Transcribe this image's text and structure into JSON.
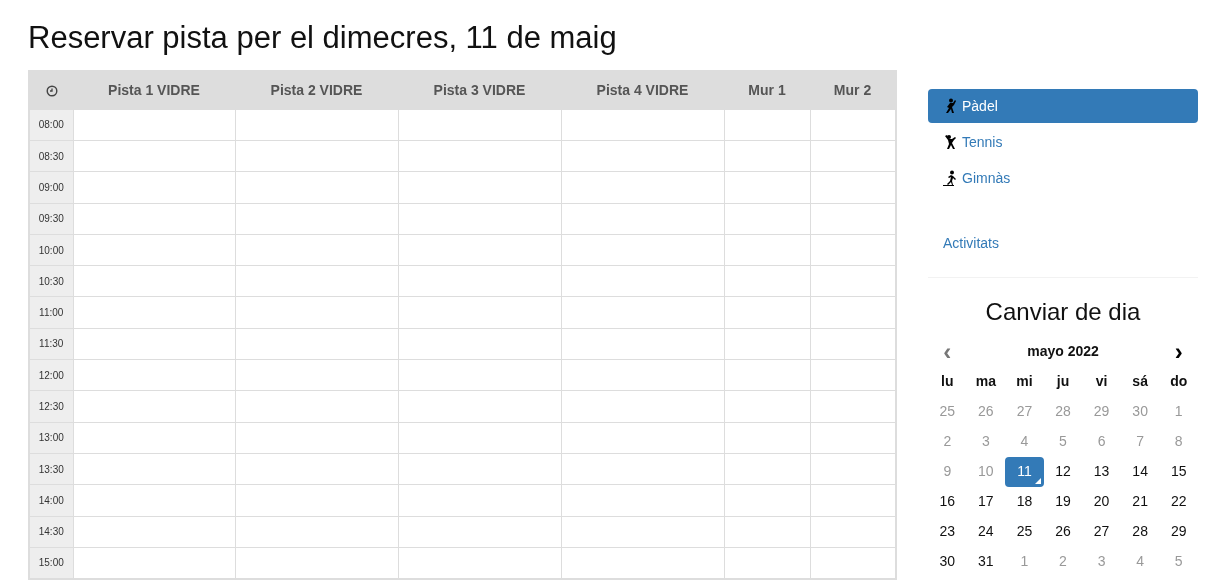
{
  "title": "Reservar pista per el dimecres, 11 de maig",
  "schedule": {
    "columns": [
      "Pista 1 VIDRE",
      "Pista 2 VIDRE",
      "Pista 3 VIDRE",
      "Pista 4 VIDRE",
      "Mur 1",
      "Mur 2"
    ],
    "times": [
      "08:00",
      "08:30",
      "09:00",
      "09:30",
      "10:00",
      "10:30",
      "11:00",
      "11:30",
      "12:00",
      "12:30",
      "13:00",
      "13:30",
      "14:00",
      "14:30",
      "15:00"
    ]
  },
  "sidebar": {
    "sports": [
      {
        "label": "Pàdel",
        "kind": "racket",
        "selected": true
      },
      {
        "label": "Tennis",
        "kind": "tennis",
        "selected": false
      },
      {
        "label": "Gimnàs",
        "kind": "gym",
        "selected": false
      }
    ],
    "link": "Activitats"
  },
  "calendar": {
    "title": "Canviar de dia",
    "prev": "‹",
    "month": "mayo 2022",
    "next": "›",
    "weekdays": [
      "lu",
      "ma",
      "mi",
      "ju",
      "vi",
      "sá",
      "do"
    ],
    "days": [
      {
        "label": "25",
        "muted": true,
        "selected": false
      },
      {
        "label": "26",
        "muted": true,
        "selected": false
      },
      {
        "label": "27",
        "muted": true,
        "selected": false
      },
      {
        "label": "28",
        "muted": true,
        "selected": false
      },
      {
        "label": "29",
        "muted": true,
        "selected": false
      },
      {
        "label": "30",
        "muted": true,
        "selected": false
      },
      {
        "label": "1",
        "muted": true,
        "selected": false
      },
      {
        "label": "2",
        "muted": true,
        "selected": false
      },
      {
        "label": "3",
        "muted": true,
        "selected": false
      },
      {
        "label": "4",
        "muted": true,
        "selected": false
      },
      {
        "label": "5",
        "muted": true,
        "selected": false
      },
      {
        "label": "6",
        "muted": true,
        "selected": false
      },
      {
        "label": "7",
        "muted": true,
        "selected": false
      },
      {
        "label": "8",
        "muted": true,
        "selected": false
      },
      {
        "label": "9",
        "muted": true,
        "selected": false
      },
      {
        "label": "10",
        "muted": true,
        "selected": false
      },
      {
        "label": "11",
        "muted": false,
        "selected": true
      },
      {
        "label": "12",
        "muted": false,
        "selected": false
      },
      {
        "label": "13",
        "muted": false,
        "selected": false
      },
      {
        "label": "14",
        "muted": false,
        "selected": false
      },
      {
        "label": "15",
        "muted": false,
        "selected": false
      },
      {
        "label": "16",
        "muted": false,
        "selected": false
      },
      {
        "label": "17",
        "muted": false,
        "selected": false
      },
      {
        "label": "18",
        "muted": false,
        "selected": false
      },
      {
        "label": "19",
        "muted": false,
        "selected": false
      },
      {
        "label": "20",
        "muted": false,
        "selected": false
      },
      {
        "label": "21",
        "muted": false,
        "selected": false
      },
      {
        "label": "22",
        "muted": false,
        "selected": false
      },
      {
        "label": "23",
        "muted": false,
        "selected": false
      },
      {
        "label": "24",
        "muted": false,
        "selected": false
      },
      {
        "label": "25",
        "muted": false,
        "selected": false
      },
      {
        "label": "26",
        "muted": false,
        "selected": false
      },
      {
        "label": "27",
        "muted": false,
        "selected": false
      },
      {
        "label": "28",
        "muted": false,
        "selected": false
      },
      {
        "label": "29",
        "muted": false,
        "selected": false
      },
      {
        "label": "30",
        "muted": false,
        "selected": false
      },
      {
        "label": "31",
        "muted": false,
        "selected": false
      },
      {
        "label": "1",
        "muted": true,
        "selected": false
      },
      {
        "label": "2",
        "muted": true,
        "selected": false
      },
      {
        "label": "3",
        "muted": true,
        "selected": false
      },
      {
        "label": "4",
        "muted": true,
        "selected": false
      },
      {
        "label": "5",
        "muted": true,
        "selected": false
      }
    ]
  }
}
